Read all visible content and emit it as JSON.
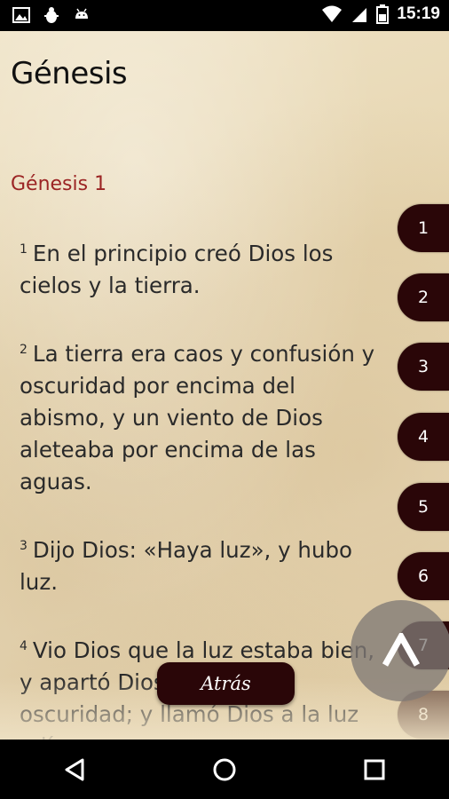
{
  "status_bar": {
    "time": "15:19",
    "left_icons": [
      "image-icon",
      "debug-bug-icon",
      "android-icon"
    ],
    "right_icons": [
      "wifi-icon",
      "cell-signal-icon",
      "battery-icon"
    ]
  },
  "book": {
    "title": "Génesis",
    "chapter_heading": "Génesis 1"
  },
  "verses": [
    {
      "num": "1",
      "text": "En el principio creó Dios los cielos y la tierra."
    },
    {
      "num": "2",
      "text": "La tierra era caos y confusión y oscuridad por encima del abismo, y un viento de Dios aleteaba por encima de las aguas."
    },
    {
      "num": "3",
      "text": "Dijo Dios: «Haya luz», y hubo luz."
    },
    {
      "num": "4",
      "text": "Vio Dios que la luz estaba bien, y apartó Dios la luz de la oscuridad; y llamó Dios a la luz «día»"
    }
  ],
  "chapter_index": [
    "1",
    "2",
    "3",
    "4",
    "5",
    "6",
    "7",
    "8"
  ],
  "back_button": {
    "label": "Atrás"
  },
  "scroll_top_button": {
    "label": "^"
  },
  "colors": {
    "accent_red": "#9b2424",
    "button_dark": "#2a0608",
    "paper": "#e9dab8"
  }
}
